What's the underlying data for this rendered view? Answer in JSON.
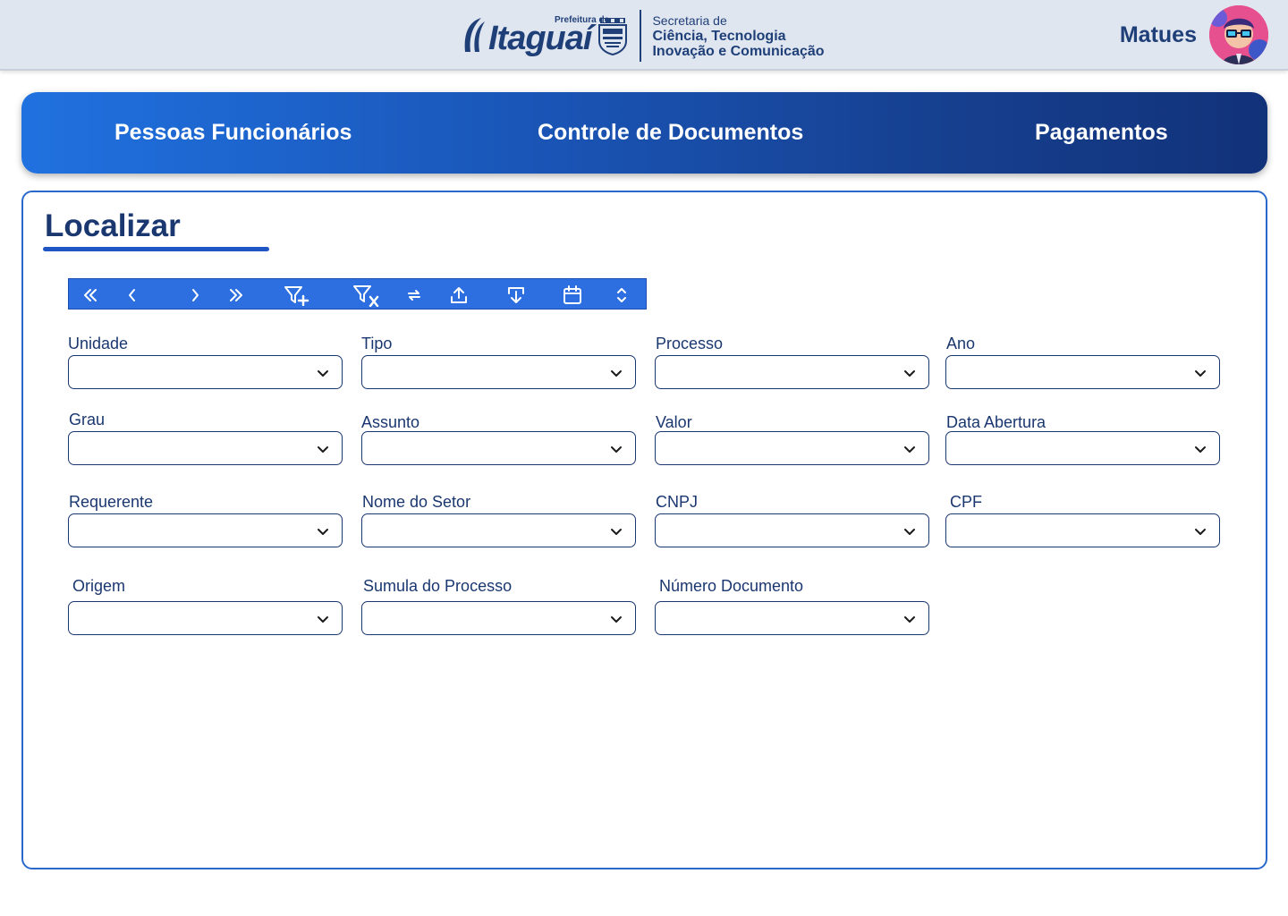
{
  "header": {
    "logo_prefix": "Prefeitura de",
    "logo_name": "Itaguaí",
    "secretaria_line1": "Secretaria de",
    "secretaria_line2": "Ciência, Tecnologia",
    "secretaria_line3": "Inovação e Comunicação",
    "user_name": "Matues"
  },
  "nav": {
    "tabs": [
      {
        "label": "Pessoas Funcionários"
      },
      {
        "label": "Controle de Documentos"
      },
      {
        "label": "Pagamentos"
      }
    ]
  },
  "panel": {
    "title": "Localizar"
  },
  "toolbar": {
    "buttons": [
      "first-page-icon",
      "previous-icon",
      "next-icon",
      "last-page-icon",
      "filter-add-icon",
      "filter-clear-icon",
      "refresh-icon",
      "upload-icon",
      "download-icon",
      "calendar-icon",
      "expand-collapse-icon"
    ]
  },
  "fields": [
    {
      "label": "Unidade",
      "value": ""
    },
    {
      "label": "Tipo",
      "value": ""
    },
    {
      "label": "Processo",
      "value": ""
    },
    {
      "label": "Ano",
      "value": ""
    },
    {
      "label": "Grau",
      "value": ""
    },
    {
      "label": "Assunto",
      "value": ""
    },
    {
      "label": "Valor",
      "value": ""
    },
    {
      "label": "Data Abertura",
      "value": ""
    },
    {
      "label": "Requerente",
      "value": ""
    },
    {
      "label": "Nome do Setor",
      "value": ""
    },
    {
      "label": "CNPJ",
      "value": ""
    },
    {
      "label": "CPF",
      "value": ""
    },
    {
      "label": "Origem",
      "value": ""
    },
    {
      "label": "Sumula do Processo",
      "value": ""
    },
    {
      "label": "Número Documento",
      "value": ""
    }
  ],
  "colors": {
    "brand_dark": "#1a3770",
    "accent": "#2d6fe0",
    "header_bg": "#e0e6f0"
  }
}
